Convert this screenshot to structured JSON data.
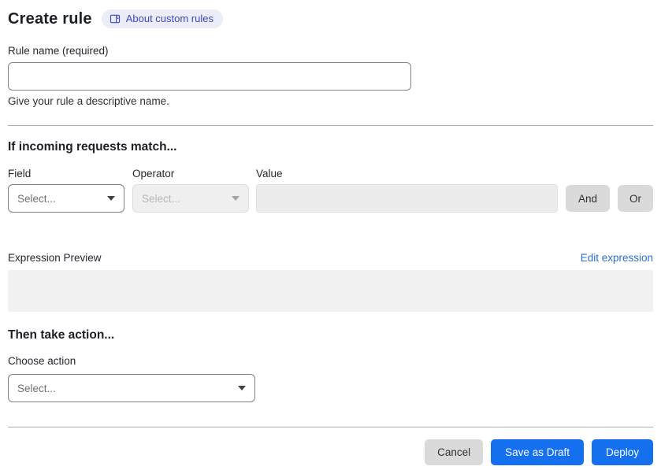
{
  "header": {
    "title": "Create rule",
    "about_badge": {
      "label": "About custom rules",
      "icon": "book-icon"
    }
  },
  "rule_name": {
    "label": "Rule name (required)",
    "value": "",
    "help": "Give your rule a descriptive name."
  },
  "match_section": {
    "heading": "If incoming requests match...",
    "field": {
      "label": "Field",
      "selected": "Select...",
      "enabled": true
    },
    "operator": {
      "label": "Operator",
      "selected": "Select...",
      "enabled": false
    },
    "value": {
      "label": "Value",
      "value": "",
      "enabled": false
    },
    "and_label": "And",
    "or_label": "Or"
  },
  "expression": {
    "label": "Expression Preview",
    "edit_link": "Edit expression",
    "preview": ""
  },
  "action_section": {
    "heading": "Then take action...",
    "choose_label": "Choose action",
    "selected": "Select..."
  },
  "footer": {
    "cancel": "Cancel",
    "save_draft": "Save as Draft",
    "deploy": "Deploy"
  },
  "icons": {
    "badge": "book-icon",
    "dropdown": "chevron-down-icon"
  },
  "colors": {
    "primary_blue": "#1570f0",
    "link_blue": "#2b6fd3",
    "badge_bg": "#ebedf9",
    "badge_text": "#3f46c0",
    "gray_button": "#dadada"
  }
}
